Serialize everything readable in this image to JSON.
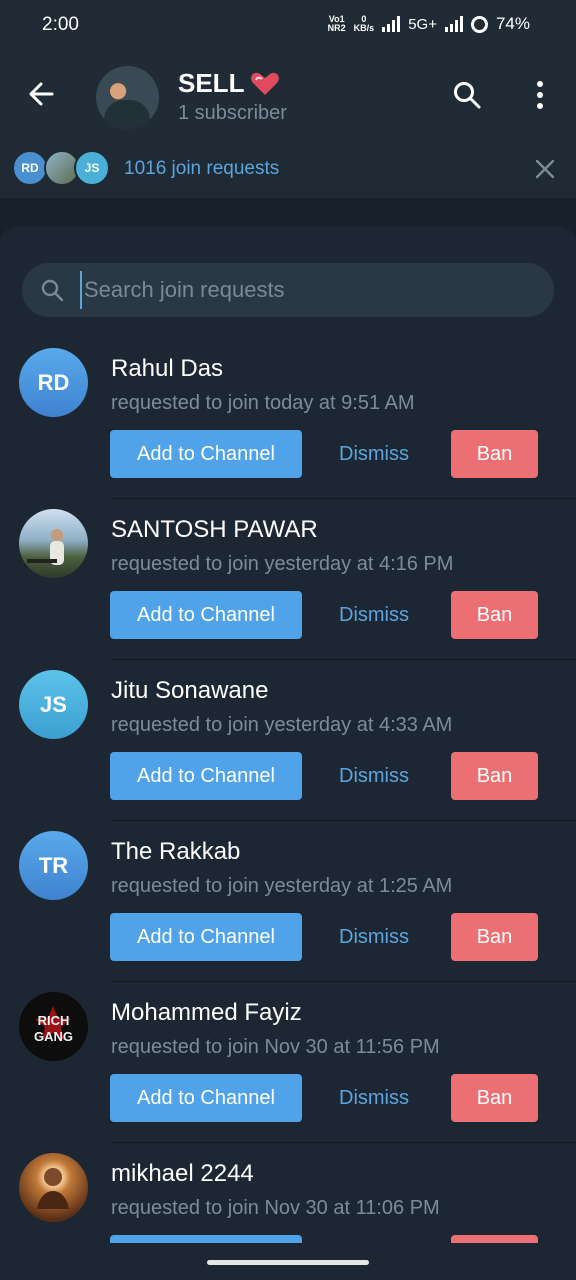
{
  "status_bar": {
    "time": "2:00",
    "volte": "Vo1",
    "nr": "NR2",
    "speed_value": "0",
    "speed_unit": "KB/s",
    "network": "5G+",
    "battery": "74%"
  },
  "header": {
    "title": "SELL",
    "subtitle": "1 subscriber",
    "icons": [
      "back-arrow-icon",
      "search-icon",
      "more-vertical-icon",
      "heart-emoji"
    ]
  },
  "join_strip": {
    "avatars": [
      {
        "initials": "RD",
        "color": "#4a8fd0"
      },
      {
        "initials": "",
        "color": "#6a7b6a"
      },
      {
        "initials": "JS",
        "color": "#4ab0d8"
      }
    ],
    "text": "1016 join requests"
  },
  "search": {
    "placeholder": "Search join requests",
    "value": ""
  },
  "actions": {
    "add": "Add to Channel",
    "dismiss": "Dismiss",
    "ban": "Ban"
  },
  "requests": [
    {
      "name": "Rahul Das",
      "time": "requested to join today at 9:51 AM",
      "initials": "RD",
      "avatar_color": "#4a8fd0",
      "photo": false
    },
    {
      "name": "SANTOSH PAWAR",
      "time": "requested to join yesterday at 4:16 PM",
      "initials": "",
      "avatar_color": "#6e8a6f",
      "photo": true
    },
    {
      "name": "Jitu Sonawane",
      "time": "requested to join yesterday at 4:33 AM",
      "initials": "JS",
      "avatar_color": "#48aedb",
      "photo": false
    },
    {
      "name": "The Rakkab",
      "time": "requested to join yesterday at 1:25 AM",
      "initials": "TR",
      "avatar_color": "#4a8fd0",
      "photo": false
    },
    {
      "name": "Mohammed Fayiz",
      "time": "requested to join Nov 30 at 11:56 PM",
      "initials": "",
      "avatar_color": "#111111",
      "photo": true,
      "logo_text": "RICH GANG"
    },
    {
      "name": "mikhael 2244",
      "time": "requested to join Nov 30 at 11:06 PM",
      "initials": "",
      "avatar_color": "#a8622a",
      "photo": true
    }
  ]
}
